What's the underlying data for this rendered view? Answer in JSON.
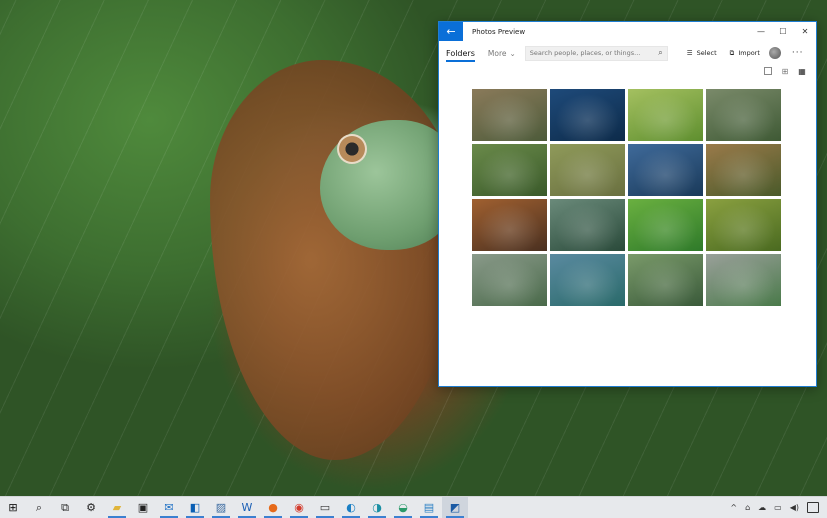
{
  "window": {
    "title": "Photos Preview",
    "back_glyph": "←",
    "controls": {
      "minimize": "—",
      "maximize": "☐",
      "close": "✕"
    }
  },
  "toolbar": {
    "folders_label": "Folders",
    "more_label": "More",
    "more_chevron": "⌄",
    "search_placeholder": "Search people, places, or things...",
    "search_glyph": "⌕",
    "select_label": "Select",
    "select_glyph": "☰",
    "import_label": "Import",
    "import_glyph": "⧉",
    "more_dots": "···"
  },
  "view_toggles": {
    "medium_glyph": "⊞",
    "small_glyph": "▦"
  },
  "photos": [
    [
      {
        "a": "#8a7a5a",
        "b": "#4d5b3a"
      },
      {
        "a": "#1e4a7a",
        "b": "#0d2b4a"
      },
      {
        "a": "#a4c060",
        "b": "#5f8f2f"
      },
      {
        "a": "#7a8a6a",
        "b": "#3f5a35"
      }
    ],
    [
      {
        "a": "#6a8a4a",
        "b": "#3a5a2a"
      },
      {
        "a": "#8f9a5a",
        "b": "#6a7040"
      },
      {
        "a": "#3f6a9a",
        "b": "#1a3a5a"
      },
      {
        "a": "#9a7a4a",
        "b": "#4a5a2a"
      }
    ],
    [
      {
        "a": "#a06030",
        "b": "#4a3020"
      },
      {
        "a": "#6a8a7a",
        "b": "#2a4a3a"
      },
      {
        "a": "#6ab040",
        "b": "#2f7a2a"
      },
      {
        "a": "#8aa040",
        "b": "#4a6a20"
      }
    ],
    [
      {
        "a": "#8a9a8a",
        "b": "#4a6a4a"
      },
      {
        "a": "#5a8aa0",
        "b": "#2a6a6a"
      },
      {
        "a": "#7a9a6a",
        "b": "#3a5a3a"
      },
      {
        "a": "#9aa09a",
        "b": "#4a7a4a"
      }
    ]
  ],
  "taskbar": {
    "items": [
      {
        "name": "start-icon",
        "glyph": "⊞",
        "color": "#111"
      },
      {
        "name": "search-icon",
        "glyph": "⌕",
        "color": "#222"
      },
      {
        "name": "task-view-icon",
        "glyph": "⧉",
        "color": "#222"
      },
      {
        "name": "settings-icon",
        "glyph": "⚙",
        "color": "#222"
      },
      {
        "name": "file-explorer-icon",
        "glyph": "▰",
        "color": "#e0b43a"
      },
      {
        "name": "store-icon",
        "glyph": "▣",
        "color": "#222"
      },
      {
        "name": "mail-icon",
        "glyph": "✉",
        "color": "#1c6fc4"
      },
      {
        "name": "outlook-icon",
        "glyph": "◧",
        "color": "#0a5fb4"
      },
      {
        "name": "photos-icon",
        "glyph": "▨",
        "color": "#3a6aa0"
      },
      {
        "name": "word-icon",
        "glyph": "W",
        "color": "#1b5fb5"
      },
      {
        "name": "firefox-icon",
        "glyph": "●",
        "color": "#e66a1a"
      },
      {
        "name": "chrome-icon",
        "glyph": "◉",
        "color": "#d33b2c"
      },
      {
        "name": "terminal-icon",
        "glyph": "▭",
        "color": "#333"
      },
      {
        "name": "edge-icon",
        "glyph": "◐",
        "color": "#1a7fc4"
      },
      {
        "name": "edge-beta-icon",
        "glyph": "◑",
        "color": "#1a8fa4"
      },
      {
        "name": "edge-dev-icon",
        "glyph": "◒",
        "color": "#2a9a6a"
      },
      {
        "name": "remote-desktop-icon",
        "glyph": "▤",
        "color": "#2a7fc4"
      },
      {
        "name": "photos-preview-icon",
        "glyph": "◩",
        "color": "#1a5aa4"
      }
    ],
    "tray": {
      "chevron": "^",
      "network": "⌂",
      "onedrive": "☁",
      "display": "▭",
      "volume": "◀)"
    }
  }
}
